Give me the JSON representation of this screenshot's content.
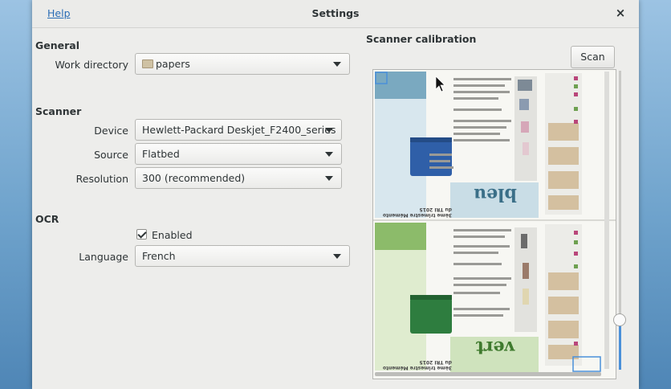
{
  "window": {
    "title": "Settings",
    "help_label": "Help",
    "close_symbol": "×"
  },
  "general": {
    "header": "General",
    "work_directory_label": "Work directory",
    "work_directory_value": "papers"
  },
  "scanner": {
    "header": "Scanner",
    "device_label": "Device",
    "device_value": "Hewlett-Packard Deskjet_F2400_series",
    "source_label": "Source",
    "source_value": "Flatbed",
    "resolution_label": "Resolution",
    "resolution_value": "300 (recommended)"
  },
  "ocr": {
    "header": "OCR",
    "enabled_label": "Enabled",
    "enabled": true,
    "language_label": "Language",
    "language_value": "French"
  },
  "calibration": {
    "header": "Scanner calibration",
    "scan_label": "Scan",
    "preview_top_word": "bleu",
    "preview_bottom_word": "vert",
    "preview_top_heading": "3ème trimestre Mémento du TRI 2015",
    "preview_bottom_heading": "3ème trimestre Mémento du TRI 2015",
    "zoom_level": 0.18
  },
  "colors": {
    "accent": "#4a90d9",
    "link": "#2a6db5",
    "trions_top": "#6a9db8",
    "trions_bottom": "#7fb05e",
    "bin_blue": "#2f5fa8",
    "bin_green": "#2e7d3f"
  }
}
